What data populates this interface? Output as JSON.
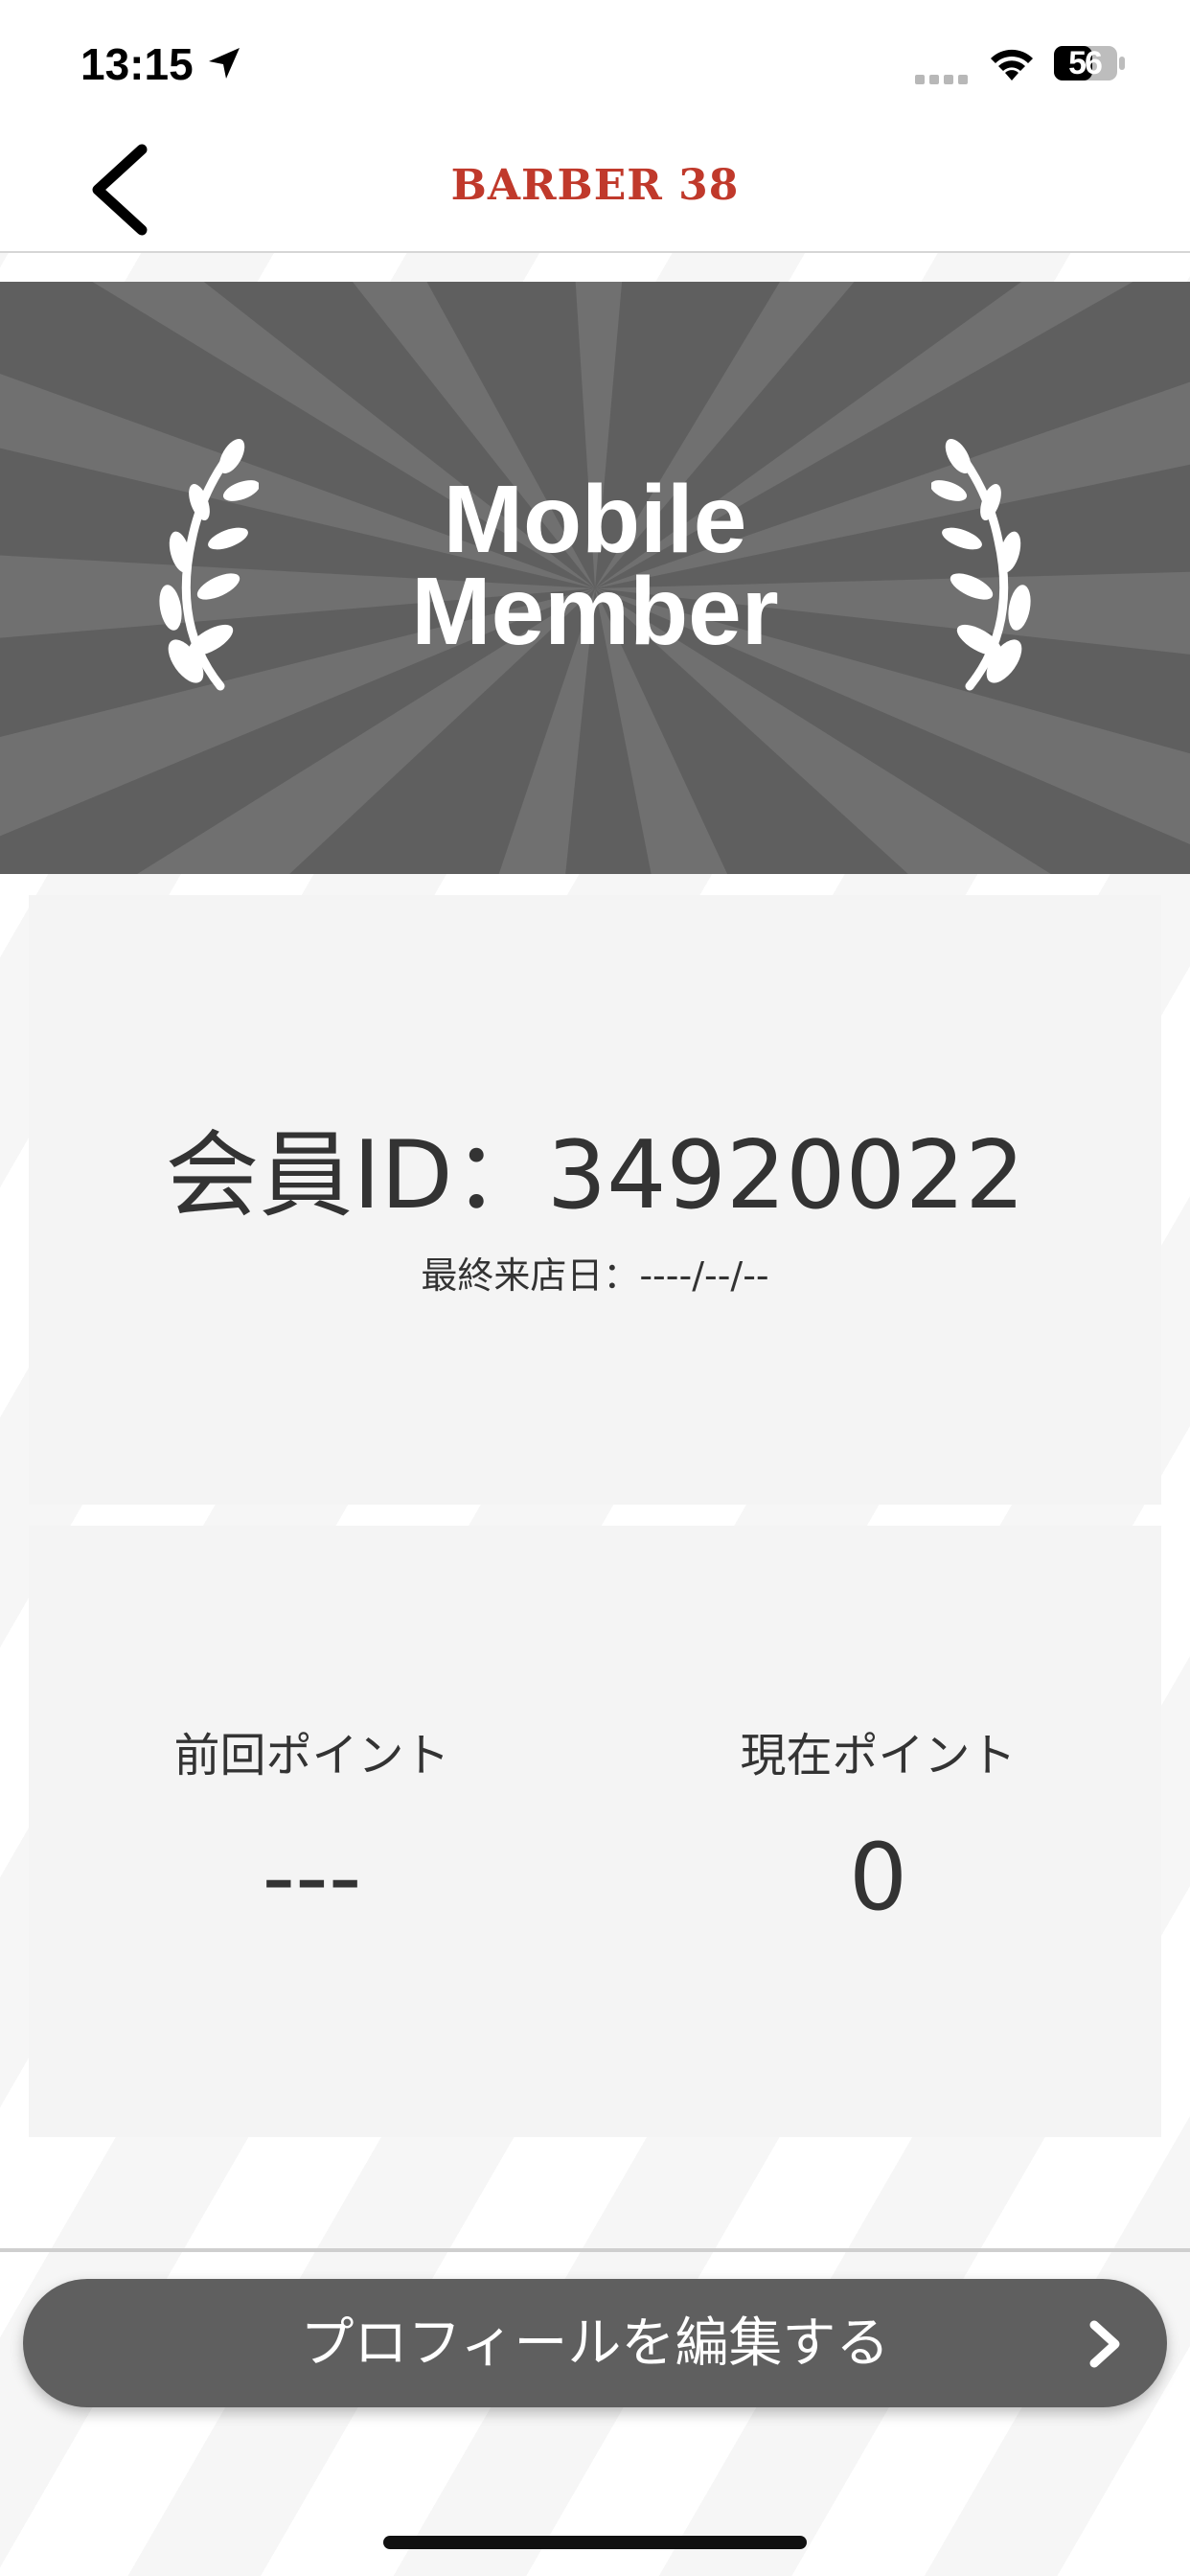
{
  "status_bar": {
    "time": "13:15",
    "battery_level": "56",
    "icons": [
      "location-arrow-icon",
      "signal-icon",
      "wifi-icon",
      "battery-icon"
    ]
  },
  "nav": {
    "brand": "BARBER 38",
    "back_icon": "chevron-left-icon"
  },
  "banner": {
    "line1": "Mobile",
    "line2": "Member",
    "icons": [
      "laurel-left-icon",
      "laurel-right-icon"
    ]
  },
  "member": {
    "id_text": "会員ID：34920022",
    "last_visit_text": "最終来店日：----/--/--"
  },
  "points": {
    "previous_label": "前回ポイント",
    "previous_value": "---",
    "current_label": "現在ポイント",
    "current_value": "0"
  },
  "actions": {
    "edit_profile_label": "プロフィールを編集する",
    "edit_profile_icon": "chevron-right-icon"
  },
  "colors": {
    "brand": "#c0392b",
    "banner_bg": "#5f5f5f",
    "card_bg": "#f4f4f4",
    "button_bg": "#5f5f5f"
  }
}
